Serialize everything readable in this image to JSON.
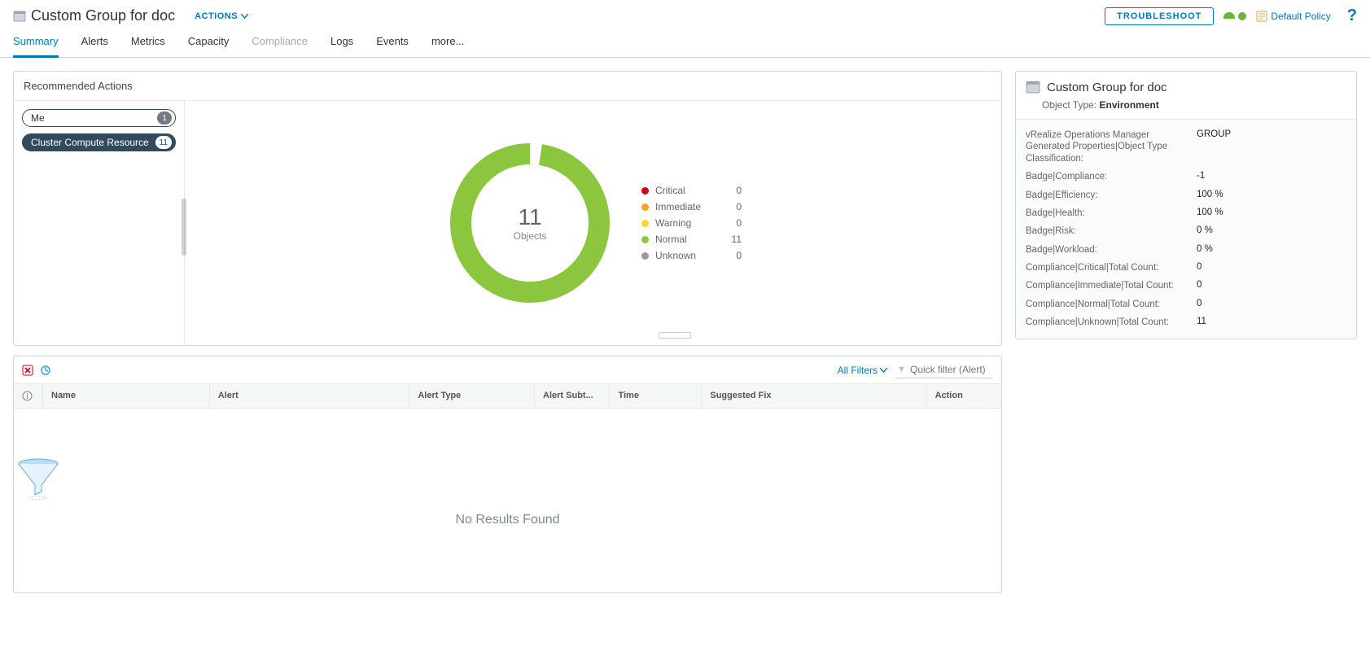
{
  "header": {
    "title": "Custom Group for doc",
    "actions_label": "ACTIONS",
    "troubleshoot_label": "TROUBLESHOOT",
    "policy_label": "Default Policy"
  },
  "tabs": {
    "summary": "Summary",
    "alerts": "Alerts",
    "metrics": "Metrics",
    "capacity": "Capacity",
    "compliance": "Compliance",
    "logs": "Logs",
    "events": "Events",
    "more": "more..."
  },
  "rec_actions": {
    "title": "Recommended Actions",
    "scopes": [
      {
        "label": "Me",
        "count": "1"
      },
      {
        "label": "Cluster Compute Resource",
        "count": "11"
      }
    ]
  },
  "chart_data": {
    "type": "pie",
    "title": "",
    "center_value": "11",
    "center_label": "Objects",
    "series": [
      {
        "name": "Critical",
        "value": 0,
        "color": "#d0021b"
      },
      {
        "name": "Immediate",
        "value": 0,
        "color": "#f5a623"
      },
      {
        "name": "Warning",
        "value": 0,
        "color": "#f8d72b"
      },
      {
        "name": "Normal",
        "value": 11,
        "color": "#8cc63f"
      },
      {
        "name": "Unknown",
        "value": 0,
        "color": "#9b9b9b"
      }
    ]
  },
  "alerts_panel": {
    "all_filters": "All Filters",
    "quick_filter_placeholder": "Quick filter (Alert)",
    "columns": {
      "name": "Name",
      "alert": "Alert",
      "alert_type": "Alert Type",
      "alert_sub": "Alert Subt...",
      "time": "Time",
      "suggested_fix": "Suggested Fix",
      "action": "Action"
    },
    "empty": "No Results Found"
  },
  "side": {
    "title": "Custom Group for doc",
    "object_type_label": "Object Type:",
    "object_type_value": "Environment",
    "props": [
      {
        "label": "vRealize Operations Manager Generated Properties|Object Type Classification:",
        "value": "GROUP"
      },
      {
        "label": "Badge|Compliance:",
        "value": "-1"
      },
      {
        "label": "Badge|Efficiency:",
        "value": "100 %"
      },
      {
        "label": "Badge|Health:",
        "value": "100 %"
      },
      {
        "label": "Badge|Risk:",
        "value": "0 %"
      },
      {
        "label": "Badge|Workload:",
        "value": "0 %"
      },
      {
        "label": "Compliance|Critical|Total Count:",
        "value": "0"
      },
      {
        "label": "Compliance|Immediate|Total Count:",
        "value": "0"
      },
      {
        "label": "Compliance|Normal|Total Count:",
        "value": "0"
      },
      {
        "label": "Compliance|Unknown|Total Count:",
        "value": "11"
      }
    ]
  }
}
